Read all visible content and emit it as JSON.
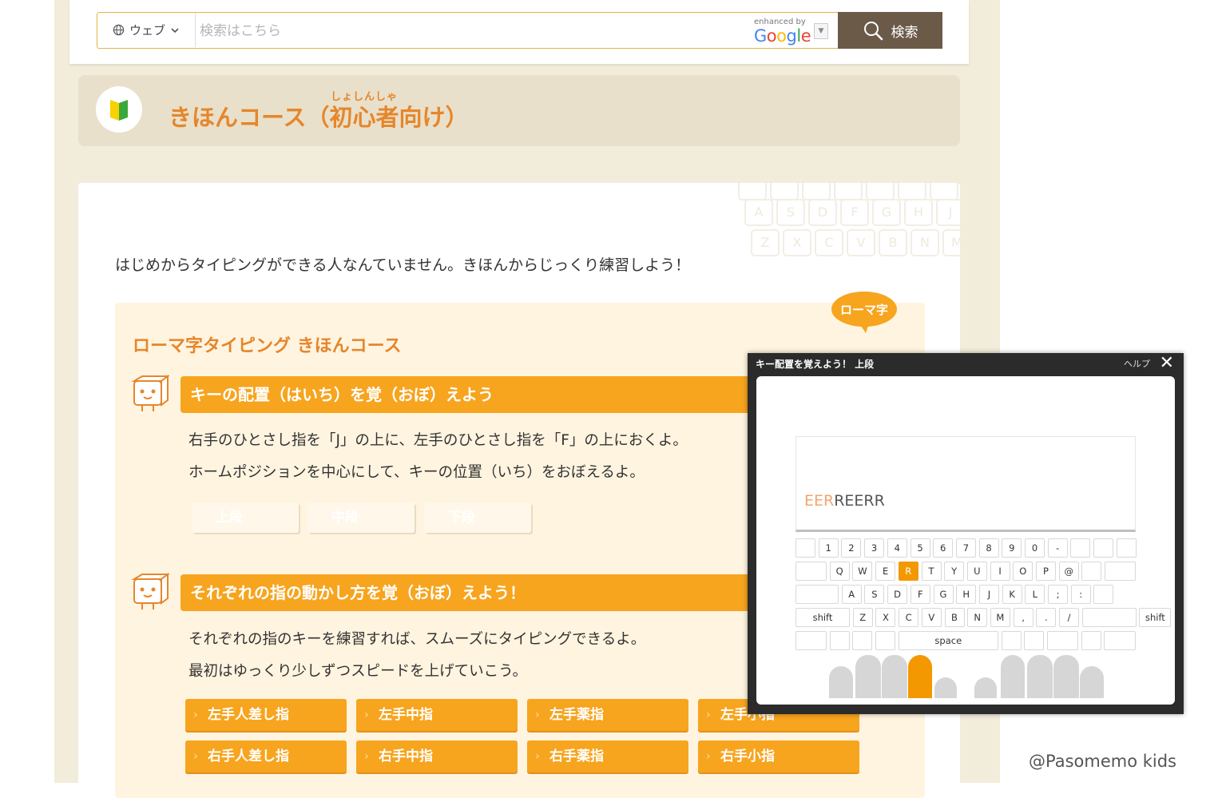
{
  "search": {
    "scope_label": "ウェブ",
    "placeholder": "検索はこちら",
    "enhanced_by": "enhanced by",
    "google": "Google",
    "button_label": "検索"
  },
  "course": {
    "title": "きほんコース（初心者向け）",
    "ruby": "しょしんしゃ"
  },
  "intro": "はじめからタイピングができる人なんていません。きほんからじっくり練習しよう！",
  "romaji_badge": "ローマ字",
  "panel": {
    "heading": "ローマ字タイピング きほんコース",
    "section1": {
      "title": "キーの配置（はいち）を覚（おぼ）えよう",
      "desc1": "右手のひとさし指を「J」の上に、左手のひとさし指を「F」の上におくよ。",
      "desc2": "ホームポジションを中心にして、キーの位置（いち）をおぼえるよ。",
      "rows": [
        "上段",
        "中段",
        "下段"
      ]
    },
    "section2": {
      "title": "それぞれの指の動かし方を覚（おぼ）えよう！",
      "desc1": "それぞれの指のキーを練習すれば、スムーズにタイピングできるよ。",
      "desc2": "最初はゆっくり少しずつスピードを上げていこう。",
      "fingers": [
        "左手人差し指",
        "左手中指",
        "左手薬指",
        "左手小指",
        "右手人差し指",
        "右手中指",
        "右手薬指",
        "右手小指"
      ]
    }
  },
  "modal": {
    "title": "キー配置を覚えよう！ 上段",
    "help": "ヘルプ",
    "typed_done": "EER",
    "typed_rest": "REERR",
    "keys": {
      "row1": [
        "",
        "1",
        "2",
        "3",
        "4",
        "5",
        "6",
        "7",
        "8",
        "9",
        "0",
        "-",
        "",
        "",
        ""
      ],
      "row2": [
        "",
        "Q",
        "W",
        "E",
        "R",
        "T",
        "Y",
        "U",
        "I",
        "O",
        "P",
        "@",
        "",
        ""
      ],
      "row3": [
        "",
        "A",
        "S",
        "D",
        "F",
        "G",
        "H",
        "J",
        "K",
        "L",
        ";",
        ":",
        ""
      ],
      "row4": [
        "shift",
        "Z",
        "X",
        "C",
        "V",
        "B",
        "N",
        "M",
        ",",
        ".",
        "/",
        "",
        "shift"
      ],
      "row5": [
        "",
        "",
        "",
        "",
        "space",
        "",
        "",
        "",
        "",
        ""
      ]
    },
    "active_key": "R",
    "active_finger": 3
  },
  "credit": "@Pasomemo kids",
  "colors": {
    "accent_orange": "#f7a41e",
    "title_orange": "#e6862a",
    "search_button": "#6b5a48",
    "active_key": "#f39800"
  }
}
